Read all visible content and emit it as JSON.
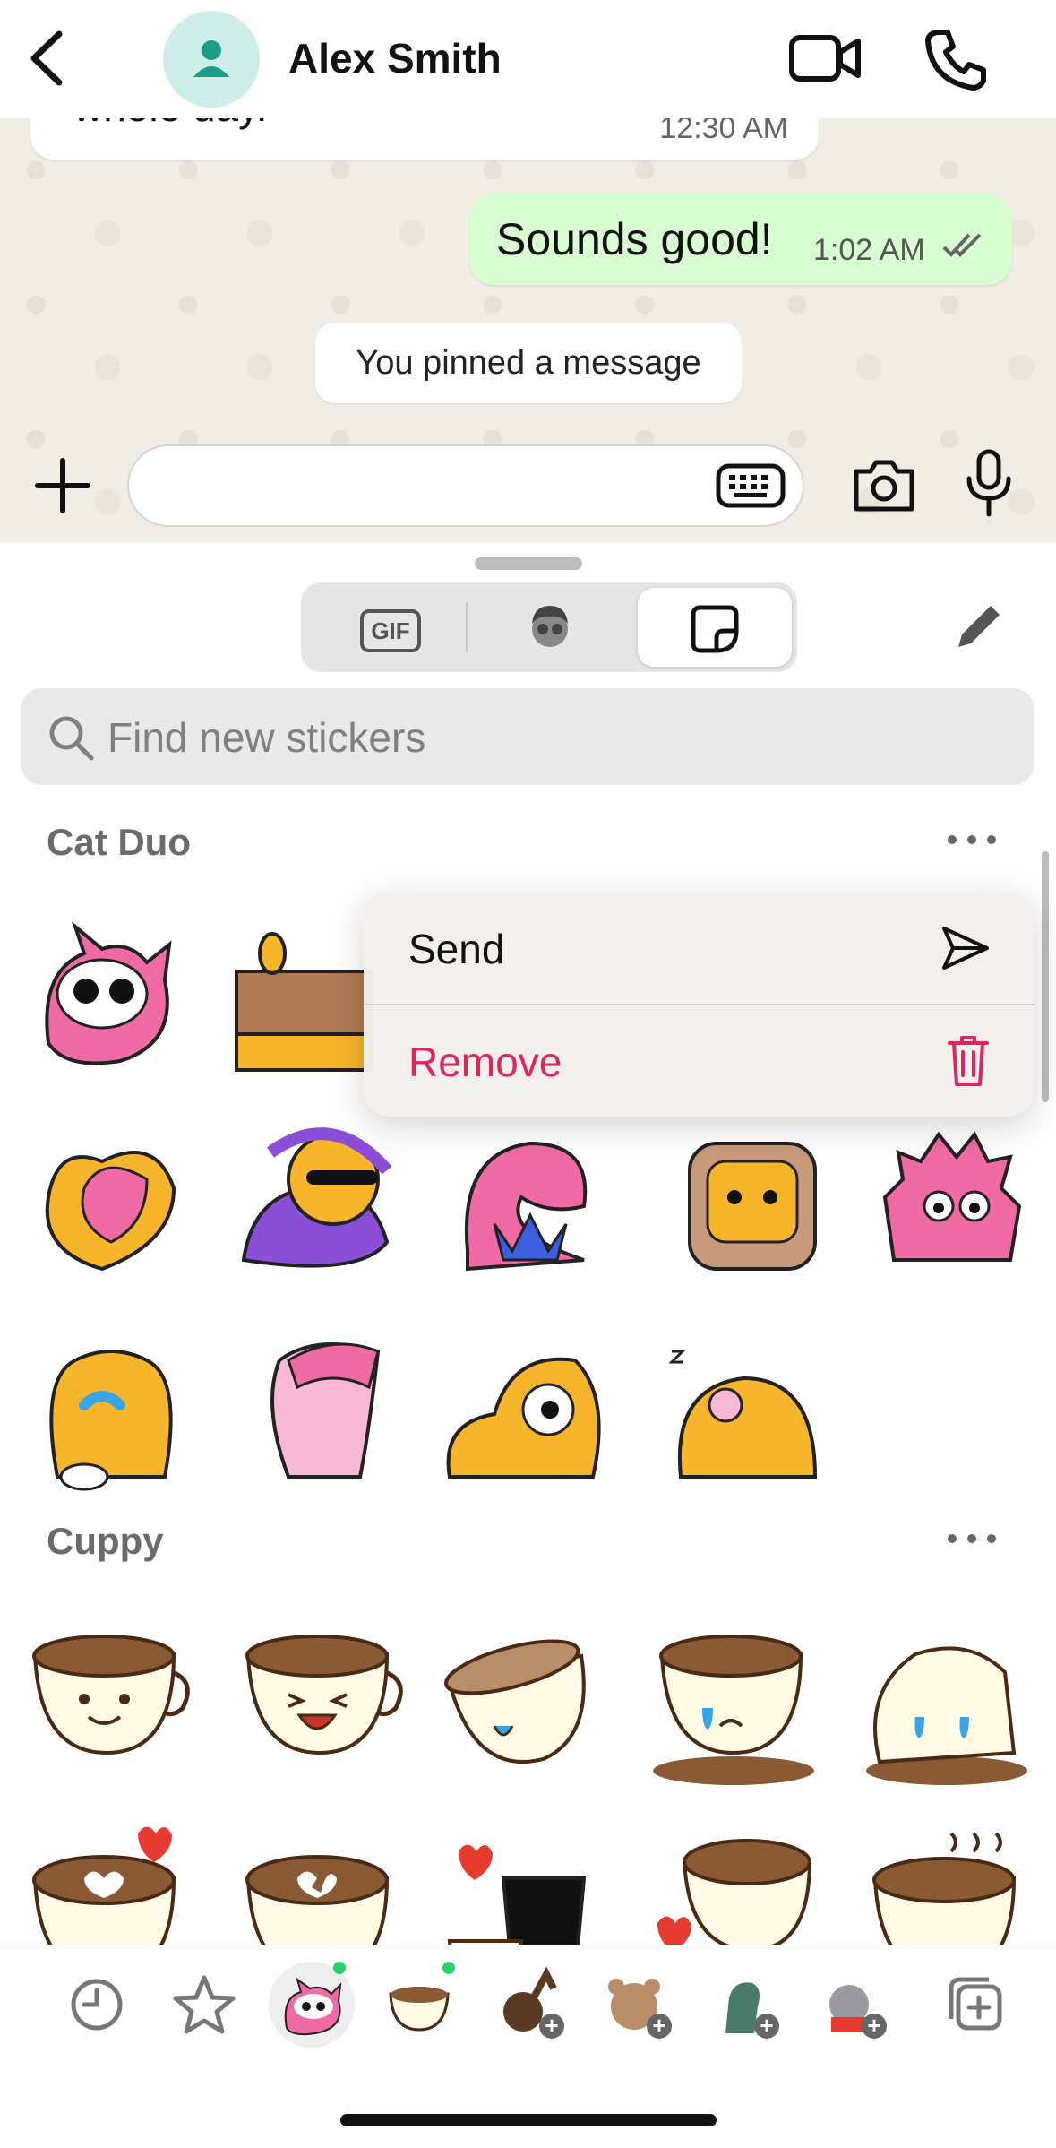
{
  "header": {
    "contact_name": "Alex Smith"
  },
  "messages": [
    {
      "text": "whole day.",
      "time": "12:30 AM",
      "direction": "incoming"
    },
    {
      "text": "Sounds good!",
      "time": "1:02 AM",
      "direction": "outgoing",
      "status": "read"
    }
  ],
  "system_notice": "You pinned a message",
  "composer": {
    "input_value": ""
  },
  "picker": {
    "gif_label": "GIF",
    "tabs": [
      "gif-tab",
      "avatar-tab",
      "stickers-tab"
    ],
    "active_tab": "stickers-tab",
    "search_placeholder": "Find new stickers"
  },
  "sections": [
    {
      "title": "Cat Duo"
    },
    {
      "title": "Cuppy"
    }
  ],
  "context_menu": {
    "send_label": "Send",
    "remove_label": "Remove",
    "remove_color": "#e0245e"
  },
  "colors": {
    "chat_background": "#f2ede4",
    "outgoing_bubble": "#d9fdd3",
    "accent_green": "#25d366",
    "cat_pink": "#f06aa5",
    "cat_yellow": "#f7b52b",
    "coffee_brown": "#8a5a34"
  }
}
